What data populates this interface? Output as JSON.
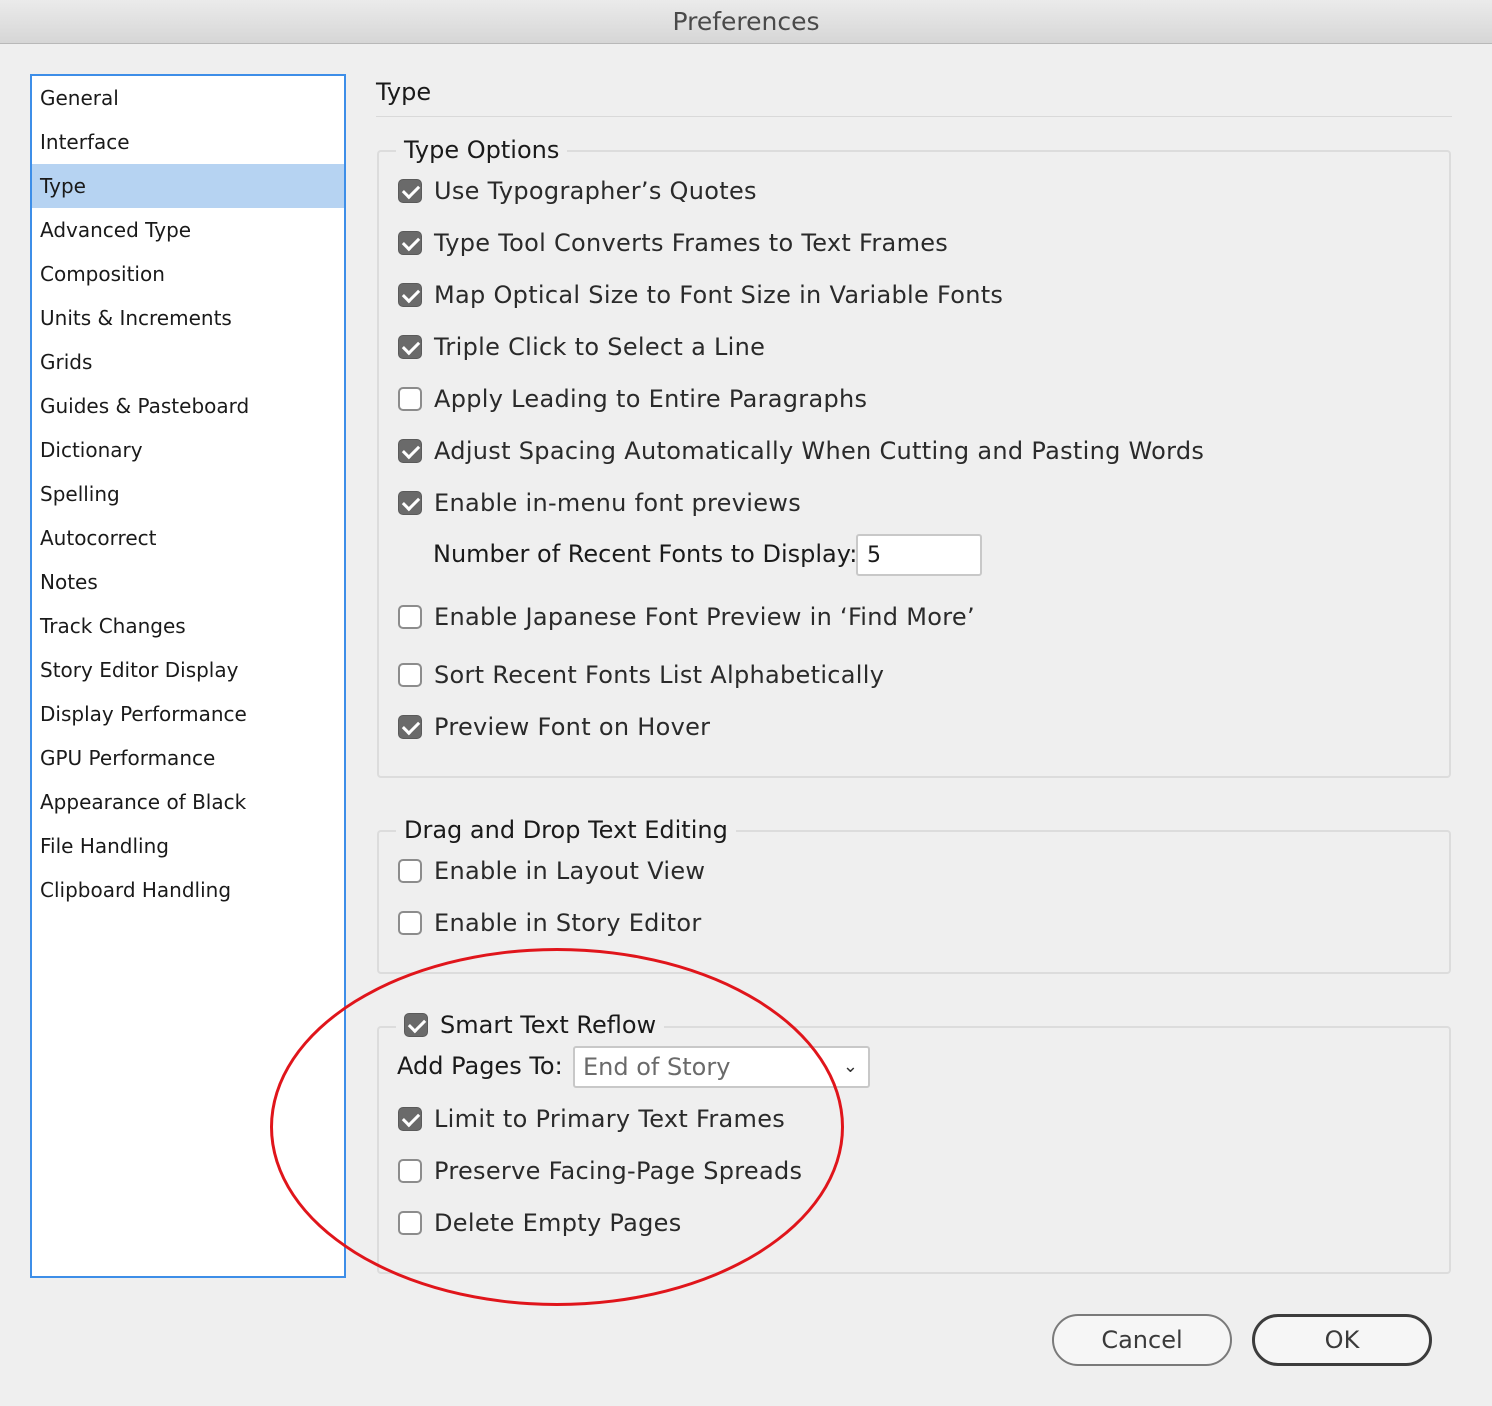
{
  "window": {
    "title": "Preferences"
  },
  "sidebar": {
    "items": [
      {
        "label": "General",
        "selected": false
      },
      {
        "label": "Interface",
        "selected": false
      },
      {
        "label": "Type",
        "selected": true
      },
      {
        "label": "Advanced Type",
        "selected": false
      },
      {
        "label": "Composition",
        "selected": false
      },
      {
        "label": "Units & Increments",
        "selected": false
      },
      {
        "label": "Grids",
        "selected": false
      },
      {
        "label": "Guides & Pasteboard",
        "selected": false
      },
      {
        "label": "Dictionary",
        "selected": false
      },
      {
        "label": "Spelling",
        "selected": false
      },
      {
        "label": "Autocorrect",
        "selected": false
      },
      {
        "label": "Notes",
        "selected": false
      },
      {
        "label": "Track Changes",
        "selected": false
      },
      {
        "label": "Story Editor Display",
        "selected": false
      },
      {
        "label": "Display Performance",
        "selected": false
      },
      {
        "label": "GPU Performance",
        "selected": false
      },
      {
        "label": "Appearance of Black",
        "selected": false
      },
      {
        "label": "File Handling",
        "selected": false
      },
      {
        "label": "Clipboard Handling",
        "selected": false
      }
    ]
  },
  "main": {
    "title": "Type",
    "type_options": {
      "legend": "Type Options",
      "options": [
        {
          "label": "Use Typographer’s Quotes",
          "checked": true
        },
        {
          "label": "Type Tool Converts Frames to Text Frames",
          "checked": true
        },
        {
          "label": "Map Optical Size to Font Size in Variable Fonts",
          "checked": true
        },
        {
          "label": "Triple Click to Select a Line",
          "checked": true
        },
        {
          "label": "Apply Leading to Entire Paragraphs",
          "checked": false
        },
        {
          "label": "Adjust Spacing Automatically When Cutting and Pasting Words",
          "checked": true
        },
        {
          "label": "Enable in-menu font previews",
          "checked": true
        }
      ],
      "recent_fonts_label": "Number of Recent Fonts to Display:",
      "recent_fonts_value": "5",
      "more_options": [
        {
          "label": "Enable Japanese Font Preview in ‘Find More’",
          "checked": false
        },
        {
          "label": "Sort Recent Fonts List Alphabetically",
          "checked": false
        },
        {
          "label": "Preview Font on Hover",
          "checked": true
        }
      ]
    },
    "drag_drop": {
      "legend": "Drag and Drop Text Editing",
      "options": [
        {
          "label": "Enable in Layout View",
          "checked": false
        },
        {
          "label": "Enable in Story Editor",
          "checked": false
        }
      ]
    },
    "smart_reflow": {
      "legend": "Smart Text Reflow",
      "checked": true,
      "add_pages_label": "Add Pages To:",
      "add_pages_value": "End of Story",
      "options": [
        {
          "label": "Limit to Primary Text Frames",
          "checked": true
        },
        {
          "label": "Preserve Facing-Page Spreads",
          "checked": false
        },
        {
          "label": "Delete Empty Pages",
          "checked": false
        }
      ]
    }
  },
  "buttons": {
    "cancel": "Cancel",
    "ok": "OK"
  },
  "colors": {
    "selection": "#b6d3f2",
    "sidebar_border": "#3d8ee8",
    "annotation": "#e0151b"
  }
}
